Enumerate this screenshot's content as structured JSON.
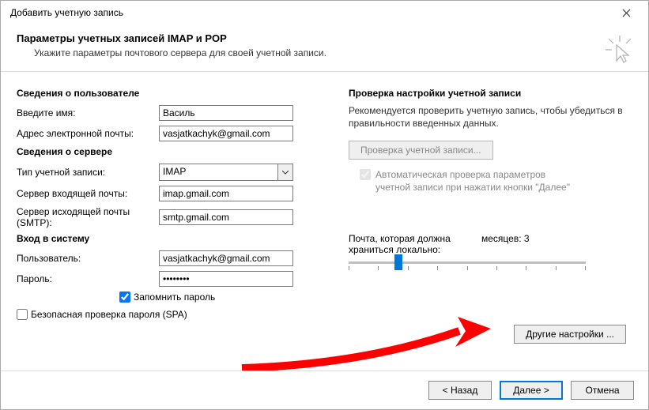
{
  "window": {
    "title": "Добавить учетную запись"
  },
  "header": {
    "title": "Параметры учетных записей IMAP и POP",
    "subtitle": "Укажите параметры почтового сервера для своей учетной записи."
  },
  "sections": {
    "user_info": "Сведения о пользователе",
    "server_info": "Сведения о сервере",
    "login_info": "Вход в систему"
  },
  "labels": {
    "name": "Введите имя:",
    "email": "Адрес электронной почты:",
    "acct_type": "Тип учетной записи:",
    "incoming": "Сервер входящей почты:",
    "outgoing": "Сервер исходящей почты (SMTP):",
    "user": "Пользователь:",
    "password": "Пароль:",
    "remember": "Запомнить пароль",
    "spa": "Безопасная проверка пароля (SPA)"
  },
  "values": {
    "name": "Василь",
    "email": "vasjatkachyk@gmail.com",
    "acct_type": "IMAP",
    "incoming": "imap.gmail.com",
    "outgoing": "smtp.gmail.com",
    "user": "vasjatkachyk@gmail.com",
    "password": "********"
  },
  "right": {
    "title": "Проверка настройки учетной записи",
    "desc": "Рекомендуется проверить учетную запись, чтобы убедиться в правильности введенных данных.",
    "test_btn": "Проверка учетной записи...",
    "auto_check": "Автоматическая проверка параметров учетной записи при нажатии кнопки \"Далее\"",
    "storage_label": "Почта, которая должна храниться локально:",
    "storage_value": "месяцев: 3",
    "more_btn": "Другие настройки ..."
  },
  "footer": {
    "back": "< Назад",
    "next": "Далее >",
    "cancel": "Отмена"
  }
}
